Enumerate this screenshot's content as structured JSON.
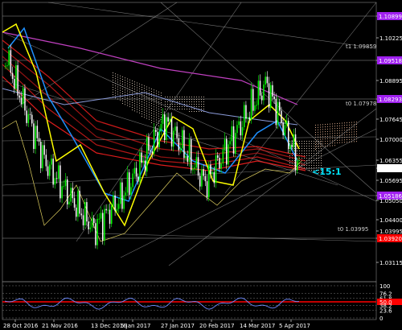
{
  "window": {
    "title": "EURUSD,Daily chart window"
  },
  "price_axis": {
    "labels": [
      "1.10899",
      "1.10225",
      "1.09518",
      "1.08895",
      "1.08293",
      "1.07645",
      "1.07000",
      "1.06355",
      "1.06097",
      "1.05695",
      "1.05186",
      "1.05050",
      "1.04400",
      "1.03995",
      "1.03920",
      "1.03115"
    ],
    "tagged": [
      {
        "label": "1.10899",
        "kind": "level"
      },
      {
        "label": "1.09518",
        "kind": "level"
      },
      {
        "label": "1.08293",
        "kind": "level"
      },
      {
        "label": "1.06097",
        "kind": "current"
      },
      {
        "label": "1.05186",
        "kind": "level"
      },
      {
        "label": "1.03920",
        "kind": "level"
      }
    ]
  },
  "oscillator_axis": {
    "labels": [
      "100",
      "76.2",
      "61.8",
      "50.0",
      "38.2",
      "23.6",
      "0"
    ]
  },
  "time_axis": {
    "labels": [
      "28 Oct 2016",
      "21 Nov 2016",
      "13 Dec 2016",
      "5 Jan 2017",
      "27 Jan 2017",
      "20 Feb 2017",
      "14 Mar 2017",
      "5 Apr 2017"
    ]
  },
  "annotations": {
    "t1_label": "t1 1.09859",
    "t0_label": "t0 1.07978",
    "t0b_label": "t0 1.03995",
    "ratio_label": "<15:1"
  },
  "colors": {
    "background": "#000000",
    "grid": "#ffffff",
    "level_tag": "#a020f0",
    "current_tag": "#ffffff",
    "red_tag": "#ff0000",
    "bull_candle": "#00ff00",
    "bear_candle": "#ffffff",
    "fast_ma": "#ffff00",
    "blue_ma": "#1e90ff",
    "red_ma": "#ff2020",
    "ratio_text": "#00e5ff"
  },
  "chart_data": {
    "type": "line",
    "title": "",
    "xlabel": "",
    "ylabel": "",
    "ylim": [
      1.03115,
      1.11
    ],
    "x": [
      "28 Oct 2016",
      "21 Nov 2016",
      "13 Dec 2016",
      "5 Jan 2017",
      "27 Jan 2017",
      "20 Feb 2017",
      "14 Mar 2017",
      "5 Apr 2017"
    ],
    "series": [
      {
        "values": [
          1.0975,
          1.063,
          1.041,
          1.051,
          1.076,
          1.056,
          1.088,
          1.063
        ]
      }
    ],
    "oscillator": {
      "ylim": [
        0,
        100
      ],
      "values": [
        40,
        35,
        30,
        35,
        45,
        40,
        55,
        40
      ]
    }
  }
}
